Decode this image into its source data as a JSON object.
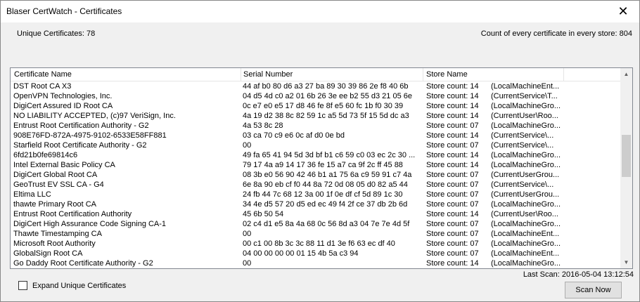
{
  "window": {
    "title": "Blaser CertWatch - Certificates",
    "close_glyph": "✕"
  },
  "summary": {
    "unique_label": "Unique Certificates: 78",
    "count_label": "Count of every certificate in every store: 804"
  },
  "table": {
    "columns": [
      "Certificate Name",
      "Serial Number",
      "Store Name",
      ""
    ],
    "rows": [
      {
        "name": "DST Root CA X3",
        "serial": "44 af b0 80 d6 a3 27 ba 89 30 39 86 2e f8 40 6b",
        "count": "Store count: 14",
        "store": "(LocalMachineEnt..."
      },
      {
        "name": "OpenVPN Technologies, Inc.",
        "serial": "04 d5 4d c0 a2 01 6b 26 3e ee b2 55 d3 21 05 6e",
        "count": "Store count: 14",
        "store": "(CurrentService\\T..."
      },
      {
        "name": "DigiCert Assured ID Root CA",
        "serial": "0c e7 e0 e5 17 d8 46 fe 8f e5 60 fc 1b f0 30 39",
        "count": "Store count: 14",
        "store": "(LocalMachineGro..."
      },
      {
        "name": "NO LIABILITY ACCEPTED, (c)97 VeriSign, Inc.",
        "serial": "4a 19 d2 38 8c 82 59 1c a5 5d 73 5f 15 5d dc a3",
        "count": "Store count: 14",
        "store": "(CurrentUser\\Roo..."
      },
      {
        "name": "Entrust Root Certification Authority - G2",
        "serial": "4a 53 8c 28",
        "count": "Store count: 07",
        "store": "(LocalMachineGro..."
      },
      {
        "name": "908E76FD-872A-4975-9102-6533E58FF881",
        "serial": "03 ca 70 c9 e6 0c af d0 0e bd",
        "count": "Store count: 14",
        "store": "(CurrentService\\..."
      },
      {
        "name": "Starfield Root Certificate Authority - G2",
        "serial": "00",
        "count": "Store count: 07",
        "store": "(CurrentService\\..."
      },
      {
        "name": "6fd21b0fe69814c6",
        "serial": "49 fa 65 41 94 5d 3d bf b1 c6 59 c0 03 ec 2c 30 ...",
        "count": "Store count: 14",
        "store": "(LocalMachineGro..."
      },
      {
        "name": "Intel External Basic Policy CA",
        "serial": "79 17 4a a9 14 17 36 fe 15 a7 ca 9f 2c ff 45 88",
        "count": "Store count: 14",
        "store": "(LocalMachineGro..."
      },
      {
        "name": "DigiCert Global Root CA",
        "serial": "08 3b e0 56 90 42 46 b1 a1 75 6a c9 59 91 c7 4a",
        "count": "Store count: 07",
        "store": "(CurrentUserGrou..."
      },
      {
        "name": "GeoTrust EV SSL CA - G4",
        "serial": "6e 8a 90 eb cf f0 44 8a 72 0d 08 05 d0 82 a5 44",
        "count": "Store count: 07",
        "store": "(CurrentService\\..."
      },
      {
        "name": "Eltima LLC",
        "serial": "24 fb 44 7c 68 12 3a 00 1f 0e df cf 5d 89 1c 30",
        "count": "Store count: 07",
        "store": "(CurrentUserGrou..."
      },
      {
        "name": "thawte Primary Root CA",
        "serial": "34 4e d5 57 20 d5 ed ec 49 f4 2f ce 37 db 2b 6d",
        "count": "Store count: 07",
        "store": "(LocalMachineGro..."
      },
      {
        "name": "Entrust Root Certification Authority",
        "serial": "45 6b 50 54",
        "count": "Store count: 14",
        "store": "(CurrentUser\\Roo..."
      },
      {
        "name": "DigiCert High Assurance Code Signing CA-1",
        "serial": "02 c4 d1 e5 8a 4a 68 0c 56 8d a3 04 7e 7e 4d 5f",
        "count": "Store count: 07",
        "store": "(LocalMachineGro..."
      },
      {
        "name": "Thawte Timestamping CA",
        "serial": "00",
        "count": "Store count: 07",
        "store": "(LocalMachineEnt..."
      },
      {
        "name": "Microsoft Root Authority",
        "serial": "00 c1 00 8b 3c 3c 88 11 d1 3e f6 63 ec df 40",
        "count": "Store count: 07",
        "store": "(LocalMachineGro..."
      },
      {
        "name": "GlobalSign Root CA",
        "serial": "04 00 00 00 00 01 15 4b 5a c3 94",
        "count": "Store count: 07",
        "store": "(LocalMachineEnt..."
      },
      {
        "name": "Go Daddy Root Certificate Authority - G2",
        "serial": "00",
        "count": "Store count: 14",
        "store": "(LocalMachineGro..."
      }
    ]
  },
  "scrollbar": {
    "up_glyph": "▲",
    "down_glyph": "▼"
  },
  "status": {
    "last_scan": "Last Scan: 2016-05-04 13:12:54"
  },
  "options": {
    "expand_label": "Expand Unique Certificates",
    "expand_checked": false
  },
  "actions": {
    "scan_label": "Scan Now"
  }
}
